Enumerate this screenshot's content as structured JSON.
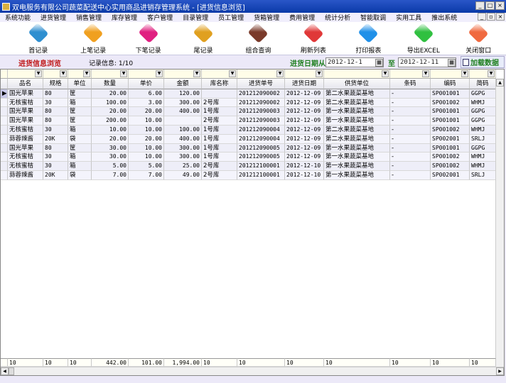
{
  "title": "双电服务有限公司蔬菜配送中心实用商品进销存管理系统 - [进货信息浏览]",
  "menu": [
    "系统功能",
    "进货管理",
    "销售管理",
    "库存管理",
    "客户管理",
    "目录管理",
    "员工管理",
    "货箱管理",
    "费用管理",
    "统计分析",
    "智能取调",
    "实用工具",
    "推出系统"
  ],
  "toolbar": [
    {
      "label": "首记录",
      "color": "#2f8fd0"
    },
    {
      "label": "上笔记录",
      "color": "#f0a020"
    },
    {
      "label": "下笔记录",
      "color": "#e02080"
    },
    {
      "label": "尾记录",
      "color": "#e0a020"
    },
    {
      "label": "组合查询",
      "color": "#7a3a2a"
    },
    {
      "label": "刷新列表",
      "color": "#e03838"
    },
    {
      "label": "打印报表",
      "color": "#2090e8"
    },
    {
      "label": "导出EXCEL",
      "color": "#30c040"
    },
    {
      "label": "关闭窗口",
      "color": "#f06a40"
    }
  ],
  "filter": {
    "title": "进货信息浏览",
    "record_info": "记录信息: 1/10",
    "date_from_label": "进货日期从",
    "date_from": "2012-12-1",
    "to_label": "至",
    "date_to": "2012-12-11",
    "load_label": "加载数据"
  },
  "columns": [
    "品名",
    "规格",
    "单位",
    "数量",
    "单价",
    "金额",
    "库名称",
    "进货单号",
    "进货日期",
    "供货单位",
    "条码",
    "编码",
    "简码"
  ],
  "rows": [
    [
      "国光苹果",
      "80",
      "筐",
      "20.00",
      "6.00",
      "120.00",
      "",
      "201212090002",
      "2012-12-09",
      "第二水果蔬菜基地",
      "-",
      "SP001001",
      "GGPG"
    ],
    [
      "无核蜜桔",
      "30",
      "箱",
      "100.00",
      "3.00",
      "300.00",
      "2号库",
      "201212090002",
      "2012-12-09",
      "第二水果蔬菜基地",
      "-",
      "SP001002",
      "WHMJ"
    ],
    [
      "国光苹果",
      "80",
      "筐",
      "20.00",
      "20.00",
      "400.00",
      "1号库",
      "201212090003",
      "2012-12-09",
      "第一水果蔬菜基地",
      "-",
      "SP001001",
      "GGPG"
    ],
    [
      "国光苹果",
      "80",
      "筐",
      "200.00",
      "10.00",
      "",
      "2号库",
      "201212090003",
      "2012-12-09",
      "第一水果蔬菜基地",
      "-",
      "SP001001",
      "GGPG"
    ],
    [
      "无核蜜桔",
      "30",
      "箱",
      "10.00",
      "10.00",
      "100.00",
      "1号库",
      "201212090004",
      "2012-12-09",
      "第二水果蔬菜基地",
      "-",
      "SP001002",
      "WHMJ"
    ],
    [
      "蒜蓉辣酱",
      "20K",
      "袋",
      "20.00",
      "20.00",
      "400.00",
      "1号库",
      "201212090004",
      "2012-12-09",
      "第二水果蔬菜基地",
      "-",
      "SP002001",
      "SRLJ"
    ],
    [
      "国光苹果",
      "80",
      "筐",
      "30.00",
      "10.00",
      "300.00",
      "1号库",
      "201212090005",
      "2012-12-09",
      "第一水果蔬菜基地",
      "-",
      "SP001001",
      "GGPG"
    ],
    [
      "无核蜜桔",
      "30",
      "箱",
      "30.00",
      "10.00",
      "300.00",
      "1号库",
      "201212090005",
      "2012-12-09",
      "第一水果蔬菜基地",
      "-",
      "SP001002",
      "WHMJ"
    ],
    [
      "无核蜜桔",
      "30",
      "箱",
      "5.00",
      "5.00",
      "25.00",
      "2号库",
      "201212100001",
      "2012-12-10",
      "第一水果蔬菜基地",
      "-",
      "SP001002",
      "WHMJ"
    ],
    [
      "蒜蓉辣酱",
      "20K",
      "袋",
      "7.00",
      "7.00",
      "49.00",
      "2号库",
      "201212100001",
      "2012-12-10",
      "第一水果蔬菜基地",
      "-",
      "SP002001",
      "SRLJ"
    ]
  ],
  "footer": [
    "10",
    "10",
    "10",
    "442.00",
    "101.00",
    "1,994.00",
    "10",
    "10",
    "10",
    "10",
    "10",
    "10",
    "10"
  ]
}
